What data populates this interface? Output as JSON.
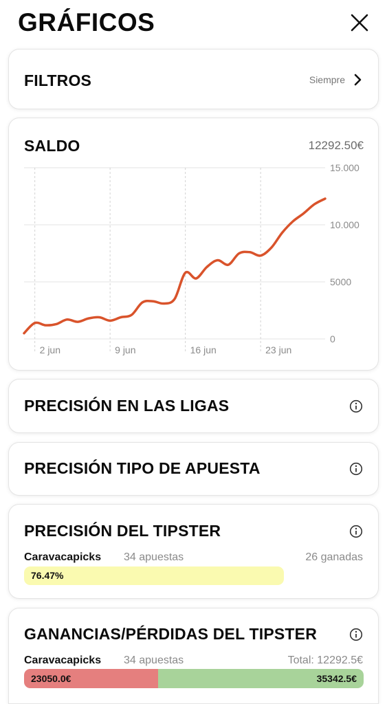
{
  "header": {
    "title": "GRÁFICOS",
    "close_icon": "close-icon"
  },
  "filters": {
    "title": "FILTROS",
    "value": "Siempre",
    "chevron_icon": "chevron-right-icon"
  },
  "saldo": {
    "title": "SALDO",
    "value": "12292.50€"
  },
  "chart_data": {
    "type": "line",
    "title": "",
    "xlabel": "",
    "ylabel": "",
    "x_tick_labels": [
      "2 jun",
      "9 jun",
      "16 jun",
      "23 jun"
    ],
    "y_tick_labels": [
      "15.000",
      "10.000",
      "5000",
      "0"
    ],
    "y_ticks": [
      15000,
      10000,
      5000,
      0
    ],
    "x_ticks": [
      "2024-06-02",
      "2024-06-09",
      "2024-06-16",
      "2024-06-23"
    ],
    "x_range": [
      "2024-06-01",
      "2024-06-29"
    ],
    "ylim": [
      0,
      15000
    ],
    "grid": true,
    "color": "#d9532b",
    "series": [
      {
        "x": [
          "2024-06-01",
          "2024-06-02",
          "2024-06-03",
          "2024-06-04",
          "2024-06-05",
          "2024-06-06",
          "2024-06-07",
          "2024-06-08",
          "2024-06-09",
          "2024-06-10",
          "2024-06-11",
          "2024-06-12",
          "2024-06-13",
          "2024-06-14",
          "2024-06-15",
          "2024-06-16",
          "2024-06-17",
          "2024-06-18",
          "2024-06-19",
          "2024-06-20",
          "2024-06-21",
          "2024-06-22",
          "2024-06-23",
          "2024-06-24",
          "2024-06-25",
          "2024-06-26",
          "2024-06-27",
          "2024-06-28",
          "2024-06-29"
        ],
        "values": [
          500,
          1400,
          1200,
          1300,
          1700,
          1500,
          1800,
          1900,
          1600,
          1900,
          2100,
          3200,
          3300,
          3100,
          3500,
          5800,
          5300,
          6300,
          6900,
          6500,
          7500,
          7600,
          7300,
          8000,
          9300,
          10300,
          11000,
          11800,
          12292.5
        ]
      }
    ]
  },
  "ligas": {
    "title": "PRECISIÓN EN LAS LIGAS",
    "info_icon": "info-icon"
  },
  "tipo": {
    "title": "PRECISIÓN TIPO DE APUESTA",
    "info_icon": "info-icon"
  },
  "precision_tipster": {
    "title": "PRECISIÓN DEL TIPSTER",
    "tipster": "Caravacapicks",
    "bets": "34 apuestas",
    "won": "26 ganadas",
    "pct_label": "76.47%",
    "accuracy": 0.7647
  },
  "ganancias": {
    "title": "GANANCIAS/PÉRDIDAS DEL TIPSTER",
    "tipster": "Caravacapicks",
    "bets": "34 apuestas",
    "total": "Total: 12292.5€",
    "loss_label": "23050.0€",
    "gain_label": "35342.5€",
    "loss_value": 23050.0,
    "gain_value": 35342.5,
    "loss_color": "#e57f7e",
    "gain_color": "#a8d39a"
  }
}
